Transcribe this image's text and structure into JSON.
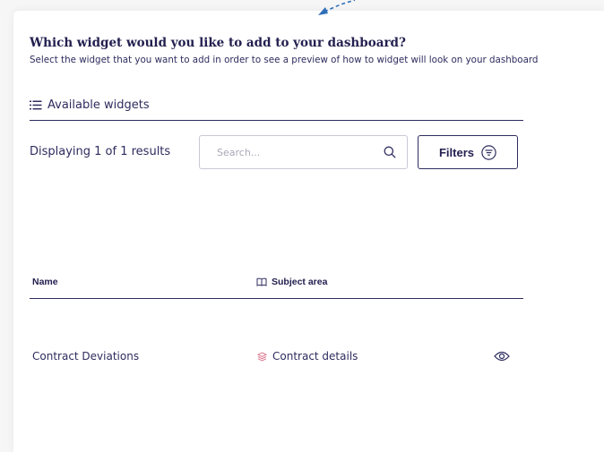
{
  "dialog": {
    "heading": "Which widget would you like to add to your dashboard?",
    "subheading": "Select the widget that you want to add in order to see a preview of how to widget will look on your dashboard"
  },
  "widgets_section": {
    "title": "Available widgets",
    "title_icon": "list-icon",
    "results_text": "Displaying 1 of 1 results",
    "search": {
      "placeholder": "Search...",
      "value": "",
      "icon": "search-icon"
    },
    "filters_button": {
      "label": "Filters",
      "icon": "filter-icon"
    }
  },
  "table": {
    "columns": [
      {
        "label": "Name"
      },
      {
        "label": "Subject area",
        "icon": "book-icon"
      },
      {
        "label": ""
      }
    ],
    "rows": [
      {
        "name": "Contract Deviations",
        "subject_area": "Contract details",
        "subject_icon": "layers-icon",
        "action_icon": "eye-icon"
      }
    ]
  },
  "colors": {
    "primary": "#2d2c5e",
    "heading": "#22204f",
    "accent_pink": "#e07a90",
    "arrow_blue": "#2f6fb8",
    "background": "#f6f6f6",
    "panel": "#ffffff"
  }
}
